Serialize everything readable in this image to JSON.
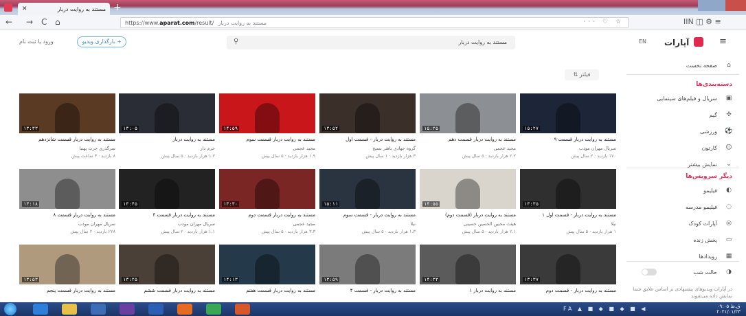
{
  "browser": {
    "tab_title": "مستند به روایت دربار",
    "tab_close": "✕",
    "new_tab": "+",
    "url_prefix": "https://www.",
    "url_domain": "aparat.com",
    "url_suffix": "/result/",
    "url_query": "مستند به روایت دربار",
    "url_right_icons": "··· ♡ ☆",
    "nav_back": "←",
    "nav_forward": "→",
    "nav_reload": "C",
    "nav_home": "⌂",
    "tools": "IIN ◫ ⚙ ≡"
  },
  "header": {
    "login": "ورود یا ثبت نام",
    "upload": "بارگذاری ویدیو +",
    "search_value": "مستند به روایت دربار",
    "logo": "آپارات",
    "lang": "EN"
  },
  "sidebar": {
    "home": "صفحه نخست",
    "categories_title": "دسته‌بندی‌ها",
    "categories": [
      {
        "icon": "film-icon",
        "glyph": "▣",
        "label": "سریال و فیلم‌های سینمایی"
      },
      {
        "icon": "game-icon",
        "glyph": "✣",
        "label": "گیم"
      },
      {
        "icon": "sport-icon",
        "glyph": "⚽",
        "label": "ورزشی"
      },
      {
        "icon": "cartoon-icon",
        "glyph": "☺",
        "label": "کارتون"
      },
      {
        "icon": "chevron-down-icon",
        "glyph": "⌄",
        "label": "نمایش بیشتر"
      }
    ],
    "services_title": "دیگر سرویس‌ها",
    "services": [
      {
        "icon": "filimo-icon",
        "glyph": "◐",
        "label": "فیلیمو"
      },
      {
        "icon": "filimo-school-icon",
        "glyph": "◌",
        "label": "فیلیمو مدرسه"
      },
      {
        "icon": "kids-icon",
        "glyph": "◎",
        "label": "آپارات کودک"
      },
      {
        "icon": "live-icon",
        "glyph": "▭",
        "label": "پخش زنده"
      },
      {
        "icon": "events-icon",
        "glyph": "▦",
        "label": "رویدادها"
      }
    ],
    "dark_mode": "حالت شب",
    "note": "در آپارات ویدیوهای پیشنهادی بر اساس علایق شما نمایش داده می‌شوند"
  },
  "filter": "فیلتر",
  "videos": [
    {
      "title": "مستند به روایت دربار قسمت ۹",
      "channel": "سریال مهران مودب",
      "meta": "۱۷۰ بازدید · ۲ سال پیش",
      "duration": "۱۵:۲۷",
      "bg": "#1d2538"
    },
    {
      "title": "مستند به روایت دربار قسمت دهم",
      "channel": "مجید عجمی",
      "meta": "۲.۲ هزار بازدید · ۵ سال پیش",
      "duration": "۱۵:۲۵",
      "bg": "#8c8f93"
    },
    {
      "title": "مستند به روایت دربار - قسمت اول",
      "channel": "گروه جهادی باهنر بسیج",
      "meta": "۳ هزار بازدید · ۱ سال پیش",
      "duration": "۱۳:۵۲",
      "bg": "#3b2f2a"
    },
    {
      "title": "مستند به روایت دربار قسمت سوم",
      "channel": "مجید عجمی",
      "meta": "۱.۹ هزار بازدید · ۵ سال پیش",
      "duration": "۱۴:۵۹",
      "bg": "#c8161b"
    },
    {
      "title": "مستند به روایت دربار",
      "channel": "حرم دار",
      "meta": "۱.۲ هزار بازدید · ۵ سال پیش",
      "duration": "۱۳:۰۵",
      "bg": "#2a2d35"
    },
    {
      "title": "مستند به روایت دربار قسمت شانزدهم",
      "channel": "سرگذری جرت پهنیا",
      "meta": "۸ بازدید · ۳ ساعت پیش",
      "duration": "۱۳:۳۳",
      "bg": "#5a3a22"
    },
    {
      "title": "مستند به روایت دربار - قسمت اول ۱",
      "channel": "نیلا",
      "meta": "۱ هزار بازدید · ۵ سال پیش",
      "duration": "۱۳:۳۵",
      "bg": "#2f2f2f"
    },
    {
      "title": "مستند به روایت دربار (قسمت دوم)",
      "channel": "هیئت محبین الحسین حسینی",
      "meta": "۲.۱ هزار بازدید · ۵ سال پیش",
      "duration": "۱۴:۵۵",
      "bg": "#d9d4cc"
    },
    {
      "title": "مستند به روایت دربار - قسمت سوم",
      "channel": "نیلا",
      "meta": "۱.۳ هزار بازدید · ۵ سال پیش",
      "duration": "۱۵:۱۱",
      "bg": "#2a3440"
    },
    {
      "title": "مستند به روایت دربار قسمت دوم",
      "channel": "مجید عجمی",
      "meta": "۳.۳ هزار بازدید · ۵ سال پیش",
      "duration": "۱۳:۳۰",
      "bg": "#7a2624"
    },
    {
      "title": "مستند به روایت دربار قسمت ۳",
      "channel": "سریال مهران مودب",
      "meta": "۱.۱ هزار بازدید · ۲ سال پیش",
      "duration": "۱۳:۴۵",
      "bg": "#222222"
    },
    {
      "title": "مستند به روایت دربار قسمت ۸",
      "channel": "سریال مهران مودب",
      "meta": "۲۲۸ بازدید · ۲ سال پیش",
      "duration": "۱۳:۱۸",
      "bg": "#8e8e8e"
    },
    {
      "title": "مستند به روایت دربار - قسمت دوم",
      "channel": "",
      "meta": "",
      "duration": "۱۳:۳۷",
      "bg": "#3a3a3a"
    },
    {
      "title": "مستند به روایت دربار ۱",
      "channel": "",
      "meta": "",
      "duration": "۱۴:۳۳",
      "bg": "#5b5b5b"
    },
    {
      "title": "مستند به روایت دربار - قسمت ۴",
      "channel": "",
      "meta": "",
      "duration": "۱۳:۵۹",
      "bg": "#7b7b7b"
    },
    {
      "title": "مستند به روایت دربار قسمت هفتم",
      "channel": "",
      "meta": "",
      "duration": "۱۴:۱۳",
      "bg": "#243a4a"
    },
    {
      "title": "مستند به روایت دربار قسمت ششم",
      "channel": "",
      "meta": "",
      "duration": "۱۳:۲۵",
      "bg": "#4a4038"
    },
    {
      "title": "مستند به روایت دربار قسمت پنجم",
      "channel": "",
      "meta": "",
      "duration": "۱۳:۵۳",
      "bg": "#b09a7e"
    }
  ],
  "taskbar": {
    "apps": [
      {
        "name": "ie-app",
        "color": "#2e7fd9"
      },
      {
        "name": "explorer-app",
        "color": "#e8c04a"
      },
      {
        "name": "media-app",
        "color": "#3c6db5"
      },
      {
        "name": "vs-app",
        "color": "#6b3fa0"
      },
      {
        "name": "word-app",
        "color": "#2b5fb3"
      },
      {
        "name": "firefox-app",
        "color": "#e66a1f"
      },
      {
        "name": "chrome-app",
        "color": "#3aa757"
      },
      {
        "name": "other-app",
        "color": "#d8572a"
      }
    ],
    "tray": "FA ▲ ■ ◆ ■ ◆ ■ ◀",
    "time": "۰۹:۰۵ ق.ظ",
    "date": "۲۰۲۱/۰۱/۲۳"
  },
  "colors": {
    "accent": "#df2a4e",
    "link": "#3e8bc5"
  }
}
